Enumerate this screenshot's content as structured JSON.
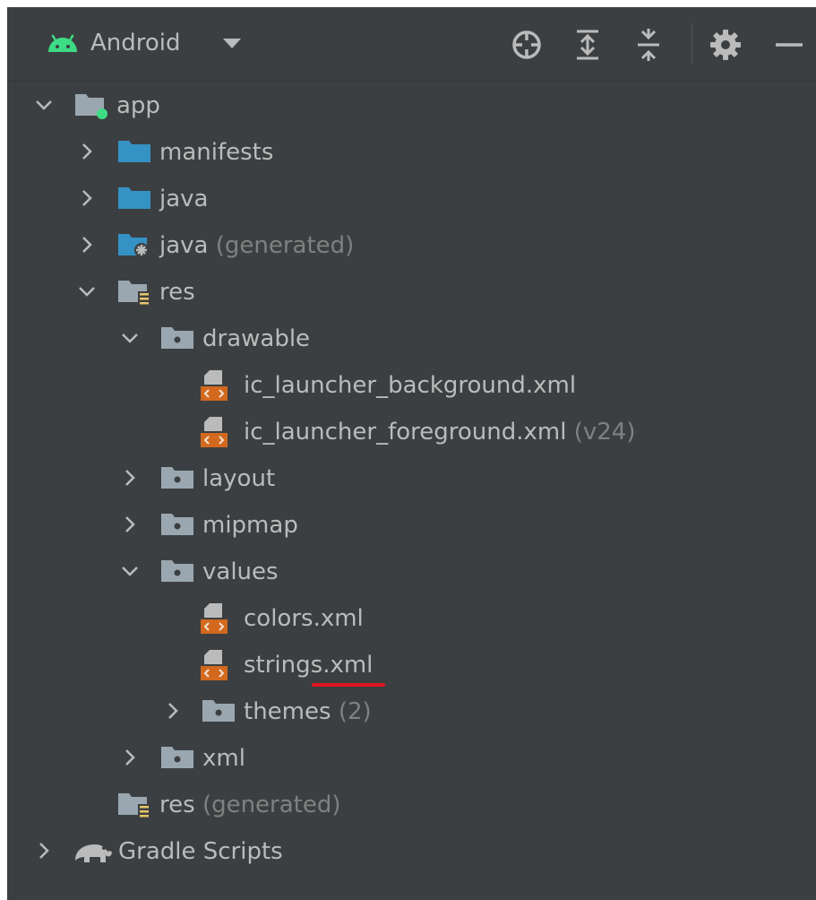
{
  "toolbar": {
    "view_label": "Android",
    "icons": {
      "logo": "android-icon",
      "dropdown": "chevron-down-icon",
      "locate": "crosshair-icon",
      "expand": "expand-all-icon",
      "collapse": "collapse-all-icon",
      "settings": "gear-icon",
      "hide": "minus-icon"
    }
  },
  "tree": {
    "app": {
      "label": "app"
    },
    "manifests": {
      "label": "manifests"
    },
    "java": {
      "label": "java"
    },
    "java_generated": {
      "label": "java",
      "hint": "(generated)"
    },
    "res": {
      "label": "res"
    },
    "drawable": {
      "label": "drawable"
    },
    "ic_launcher_background": {
      "label": "ic_launcher_background.xml"
    },
    "ic_launcher_foreground": {
      "label": "ic_launcher_foreground.xml",
      "hint": "(v24)"
    },
    "layout": {
      "label": "layout"
    },
    "mipmap": {
      "label": "mipmap"
    },
    "values": {
      "label": "values"
    },
    "colors": {
      "label": "colors.xml"
    },
    "strings": {
      "label_a": "strings",
      "label_b": ".xml"
    },
    "themes": {
      "label": "themes",
      "hint": "(2)"
    },
    "xml": {
      "label": "xml"
    },
    "res_generated": {
      "label": "res",
      "hint": "(generated)"
    },
    "gradle_scripts": {
      "label": "Gradle Scripts"
    }
  },
  "colors": {
    "panel_bg": "#3c3f41",
    "text": "#bbbbbb",
    "hint_text": "#808080",
    "android_green": "#3ddc84",
    "folder_blue": "#3592c4",
    "xml_orange": "#d2691e",
    "annotation_red": "#e0161f"
  }
}
